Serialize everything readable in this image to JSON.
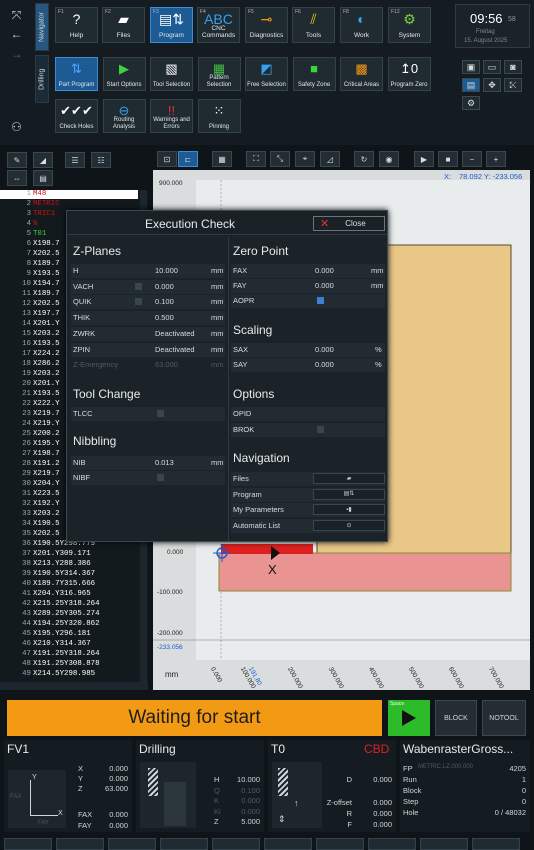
{
  "nav_side": {
    "vtab_navigator": "Navigator",
    "vtab_drilling": "Drilling"
  },
  "top_tiles": [
    {
      "fn": "F1",
      "label": "Help",
      "icon": "?"
    },
    {
      "fn": "F2",
      "label": "Files",
      "icon": "▰"
    },
    {
      "fn": "F3",
      "label": "Program",
      "icon": "▤⇅"
    },
    {
      "fn": "F4",
      "label": "CNC Commands",
      "icon": "ABC"
    },
    {
      "fn": "F5",
      "label": "Diagnostics",
      "icon": "⊸"
    },
    {
      "fn": "F6",
      "label": "Tools",
      "icon": "⫽"
    },
    {
      "fn": "F8",
      "label": "Work",
      "icon": "◐"
    },
    {
      "fn": "F12",
      "label": "System",
      "icon": "⚙"
    }
  ],
  "clock": {
    "time": "09:56",
    "seconds": "58",
    "day": "Freitag",
    "date": "15. August 2025"
  },
  "drill_tiles": [
    {
      "label": "Part Program",
      "icon": "⇅"
    },
    {
      "label": "Start Options",
      "icon": "▶"
    },
    {
      "label": "Tool Selection",
      "icon": "▧"
    },
    {
      "label": "Pattern Selection",
      "icon": "▦"
    },
    {
      "label": "Free Selection",
      "icon": "◩"
    },
    {
      "label": "Safety Zone",
      "icon": "■"
    },
    {
      "label": "Critical Areas",
      "icon": "▩"
    },
    {
      "label": "Program Zero",
      "icon": "↥0"
    },
    {
      "label": "Check Holes",
      "icon": "✔✔✔"
    },
    {
      "label": "Routing Analysis",
      "icon": "⊖"
    },
    {
      "label": "Warnings and Errors",
      "icon": "!!"
    },
    {
      "label": "Pinning",
      "icon": "⁙"
    }
  ],
  "code_lines": [
    {
      "n": "1",
      "t": "M48"
    },
    {
      "n": "2",
      "t": "METRIC"
    },
    {
      "n": "3",
      "t": "TRIC1"
    },
    {
      "n": "4",
      "t": "%"
    },
    {
      "n": "5",
      "t": "T01"
    },
    {
      "n": "6",
      "t": "X198.7"
    },
    {
      "n": "7",
      "t": "X202.5"
    },
    {
      "n": "8",
      "t": "X189.7"
    },
    {
      "n": "9",
      "t": "X193.5"
    },
    {
      "n": "10",
      "t": "X194.7"
    },
    {
      "n": "11",
      "t": "X189.7"
    },
    {
      "n": "12",
      "t": "X202.5"
    },
    {
      "n": "13",
      "t": "X197.7"
    },
    {
      "n": "14",
      "t": "X201.Y"
    },
    {
      "n": "15",
      "t": "X203.2"
    },
    {
      "n": "16",
      "t": "X193.5"
    },
    {
      "n": "17",
      "t": "X224.2"
    },
    {
      "n": "18",
      "t": "X286.2"
    },
    {
      "n": "19",
      "t": "X203.2"
    },
    {
      "n": "20",
      "t": "X201.Y"
    },
    {
      "n": "21",
      "t": "X193.5"
    },
    {
      "n": "22",
      "t": "X222.Y"
    },
    {
      "n": "23",
      "t": "X219.7"
    },
    {
      "n": "24",
      "t": "X219.Y"
    },
    {
      "n": "25",
      "t": "X200.2"
    },
    {
      "n": "26",
      "t": "X195.Y"
    },
    {
      "n": "27",
      "t": "X198.7"
    },
    {
      "n": "28",
      "t": "X191.2"
    },
    {
      "n": "29",
      "t": "X219.7"
    },
    {
      "n": "30",
      "t": "X204.Y"
    },
    {
      "n": "31",
      "t": "X223.5"
    },
    {
      "n": "32",
      "t": "X192.Y"
    },
    {
      "n": "33",
      "t": "X203.2"
    },
    {
      "n": "34",
      "t": "X190.5"
    },
    {
      "n": "35",
      "t": "X202.5"
    },
    {
      "n": "36",
      "t": "X190.5Y298.779"
    },
    {
      "n": "37",
      "t": "X201.Y309.171"
    },
    {
      "n": "38",
      "t": "X213.Y288.386"
    },
    {
      "n": "39",
      "t": "X190.5Y314.367"
    },
    {
      "n": "40",
      "t": "X189.7Y315.666"
    },
    {
      "n": "41",
      "t": "X204.Y316.965"
    },
    {
      "n": "42",
      "t": "X215.25Y318.264"
    },
    {
      "n": "43",
      "t": "X289.25Y305.274"
    },
    {
      "n": "44",
      "t": "X194.25Y320.862"
    },
    {
      "n": "45",
      "t": "X195.Y296.181"
    },
    {
      "n": "46",
      "t": "X210.Y314.367"
    },
    {
      "n": "47",
      "t": "X191.25Y318.264"
    },
    {
      "n": "48",
      "t": "X191.25Y308.878"
    },
    {
      "n": "49",
      "t": "X214.5Y298.985"
    }
  ],
  "plot": {
    "coords": "78.092 Y: -233.056",
    "coords_prefix": "X:",
    "y_ticks": [
      "900.000",
      "0.000",
      "-100.000",
      "-200.000",
      "-233.056"
    ],
    "x_ticks": [
      "0.000",
      "100.000",
      "191.80",
      "200.000",
      "300.000",
      "400.000",
      "500.000",
      "600.000",
      "700.000"
    ],
    "unit": "mm",
    "axis_x": "X"
  },
  "dialog": {
    "title": "Execution Check",
    "close": "Close",
    "zplanes": {
      "title": "Z-Planes",
      "rows": [
        {
          "k": "H",
          "v": "10.000",
          "u": "mm"
        },
        {
          "k": "VACH",
          "v": "0.000",
          "u": "mm"
        },
        {
          "k": "QUIK",
          "v": "0.100",
          "u": "mm"
        },
        {
          "k": "THIK",
          "v": "0.500",
          "u": "mm"
        },
        {
          "k": "ZWRK",
          "v": "Deactivated",
          "u": "mm"
        },
        {
          "k": "ZPIN",
          "v": "Deactivated",
          "u": "mm"
        },
        {
          "k": "Z-Emergency",
          "v": "63.000",
          "u": "mm"
        }
      ]
    },
    "toolchange": {
      "title": "Tool Change",
      "row": "TLCC"
    },
    "nibbling": {
      "title": "Nibbling",
      "nib": "NIB",
      "nib_v": "0.013",
      "nib_u": "mm",
      "nibf": "NIBF"
    },
    "zeropoint": {
      "title": "Zero Point",
      "rows": [
        {
          "k": "FAX",
          "v": "0.000",
          "u": "mm"
        },
        {
          "k": "FAY",
          "v": "0.000",
          "u": "mm"
        }
      ],
      "aopr": "AOPR"
    },
    "scaling": {
      "title": "Scaling",
      "rows": [
        {
          "k": "SAX",
          "v": "0.000",
          "u": "%"
        },
        {
          "k": "SAY",
          "v": "0.000",
          "u": "%"
        }
      ]
    },
    "options": {
      "title": "Options",
      "opid": "OPID",
      "brok": "BROK"
    },
    "navigation": {
      "title": "Navigation",
      "items": [
        "Files",
        "Program",
        "My Parameters",
        "Automatic List"
      ]
    }
  },
  "status": {
    "waiting": "Waiting for start",
    "space": "Space",
    "block": "BLOCK",
    "notool": "NOTOOL"
  },
  "fv": {
    "title": "FV1",
    "rows": [
      {
        "k": "X",
        "v": "0.000"
      },
      {
        "k": "Y",
        "v": "0.000"
      },
      {
        "k": "Z",
        "v": "63.000"
      },
      {
        "k": "FAX",
        "v": "0.000"
      },
      {
        "k": "FAY",
        "v": "0.000"
      }
    ],
    "ax_x": "X",
    "ax_y": "Y",
    "fax": "FAX",
    "fay": "FAY"
  },
  "drilling": {
    "title": "Drilling",
    "rows": [
      {
        "k": "H",
        "v": "10.000"
      },
      {
        "k": "Q",
        "v": "0.100"
      },
      {
        "k": "K",
        "v": "0.000"
      },
      {
        "k": "Ki",
        "v": "0.000"
      },
      {
        "k": "Z",
        "v": "5.000"
      }
    ]
  },
  "tool": {
    "title": "T0",
    "cbd": "CBD",
    "rows": [
      {
        "k": "D",
        "v": "0.000"
      },
      {
        "k": "Z-offset",
        "v": "0.000"
      },
      {
        "k": "R",
        "v": "0.000"
      },
      {
        "k": "F",
        "v": "0.000"
      }
    ]
  },
  "job": {
    "title": "WabenrasterGross...",
    "rows": [
      {
        "k": "FP",
        "m": "METRIC,LZ,000.000",
        "v": "4205"
      },
      {
        "k": "Run",
        "m": "",
        "v": "1"
      },
      {
        "k": "Block",
        "m": "",
        "v": "0"
      },
      {
        "k": "Step",
        "m": "",
        "v": "0"
      },
      {
        "k": "Hole",
        "m": "",
        "v": "0 / 48032"
      }
    ]
  }
}
